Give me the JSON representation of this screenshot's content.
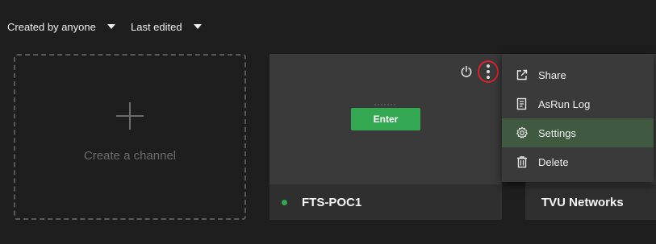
{
  "filters": {
    "creator_label": "Created by anyone",
    "sort_label": "Last edited"
  },
  "create_card": {
    "label": "Create a channel"
  },
  "channels": [
    {
      "name": "FTS-POC1",
      "status": "online",
      "status_color": "#34a853",
      "enter_label": "Enter"
    },
    {
      "name": "TVU Networks"
    }
  ],
  "context_menu": {
    "items": [
      {
        "label": "Share",
        "icon": "share-icon"
      },
      {
        "label": "AsRun Log",
        "icon": "log-icon"
      },
      {
        "label": "Settings",
        "icon": "gear-icon",
        "highlighted": true
      },
      {
        "label": "Delete",
        "icon": "trash-icon"
      }
    ]
  },
  "colors": {
    "background": "#1e1e1e",
    "accent_green": "#34a853",
    "highlight_circle": "#d9232d"
  }
}
